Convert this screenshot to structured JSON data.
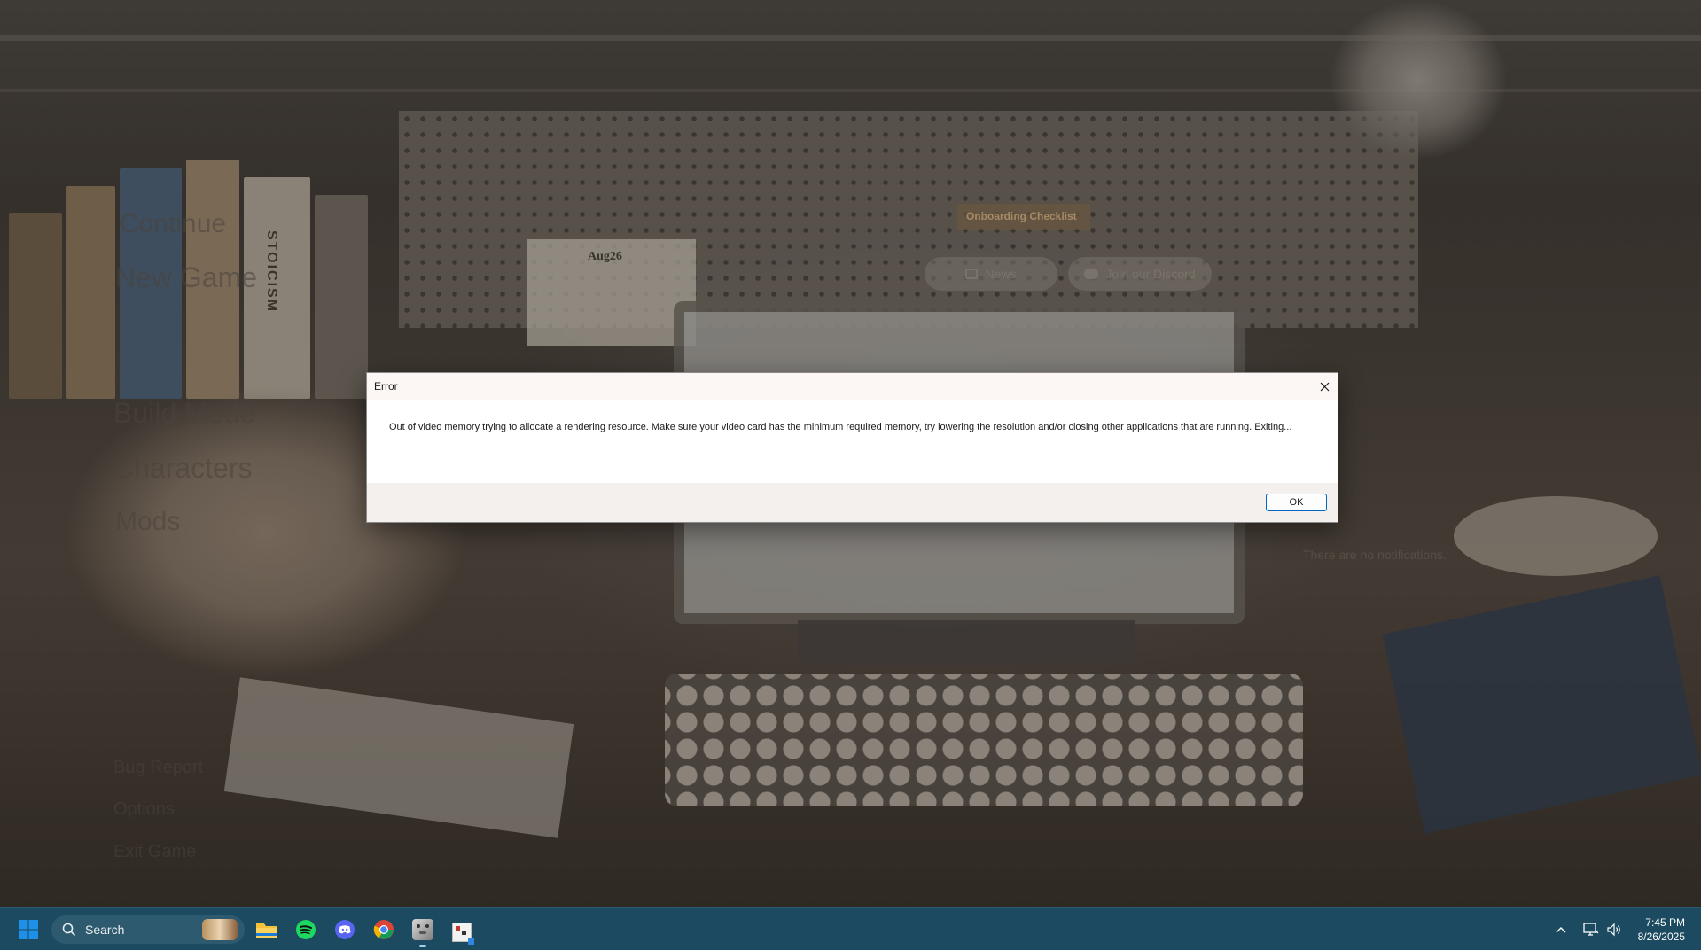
{
  "background": {
    "menu_items": [
      "Continue",
      "New Game",
      "Build Mode",
      "Characters",
      "Mods",
      "Bug Report",
      "Options",
      "Exit Game"
    ],
    "header_links": {
      "news": "News",
      "discord": "Join our Discord"
    },
    "notifications_text": "There are no notifications.",
    "desk_note_title": "Aug26",
    "pinned_card_title": "Onboarding Checklist",
    "book_spine": "STOICISM"
  },
  "dialog": {
    "title": "Error",
    "message": "Out of video memory trying to allocate a rendering resource. Make sure your video card has the minimum required memory, try lowering the resolution and/or closing other applications that are running. Exiting...",
    "ok_label": "OK"
  },
  "taskbar": {
    "search_placeholder": "Search",
    "pinned_apps": [
      "start-icon",
      "file-explorer-icon",
      "spotify-icon",
      "discord-icon",
      "chrome-icon",
      "game-app-icon",
      "pixel-app-icon"
    ],
    "time": "7:45 PM",
    "date": "8/26/2025"
  },
  "colors": {
    "taskbar_bg": "#1c4a60",
    "dialog_button_border": "#0067c0",
    "windows_blue": "#1e90e8"
  }
}
